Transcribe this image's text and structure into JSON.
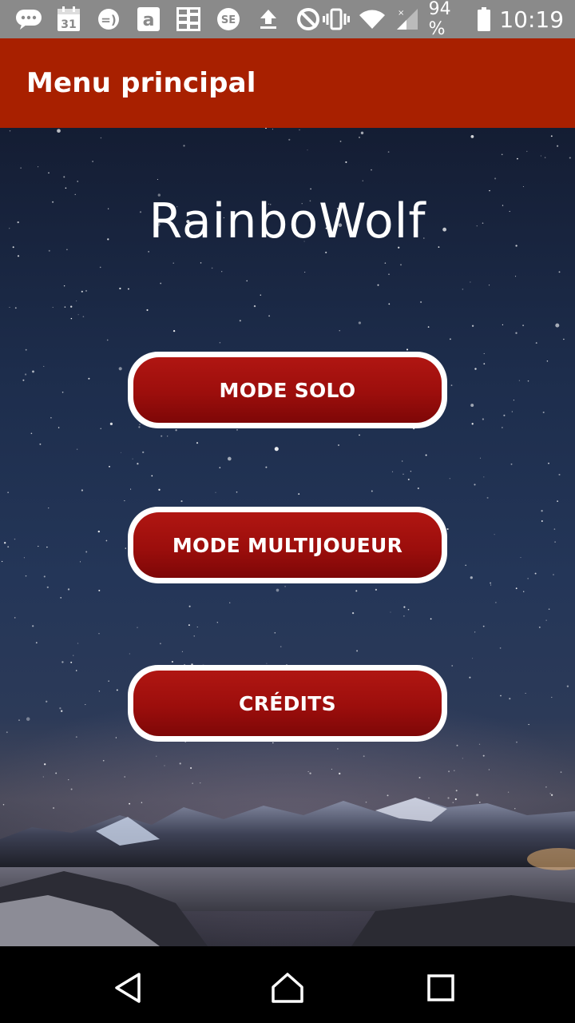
{
  "status_bar": {
    "battery_percent": "94 %",
    "time": "10:19",
    "icons": [
      "chat-bubble-icon",
      "calendar-icon",
      "message-icon",
      "amazon-icon",
      "app-grid-icon",
      "sf-icon",
      "upload-icon",
      "no-sync-icon",
      "vibrate-icon",
      "wifi-icon",
      "signal-icon",
      "battery-icon"
    ],
    "calendar_day": "31"
  },
  "app_bar": {
    "title": "Menu principal",
    "color": "#a82000"
  },
  "main": {
    "logo_text": "RainboWolf",
    "buttons": [
      {
        "label": "MODE SOLO"
      },
      {
        "label": "MODE MULTIJOUEUR"
      },
      {
        "label": "CRÉDITS"
      }
    ],
    "button_color": "#9c0e0c"
  },
  "nav_bar": {
    "icons": [
      "back-icon",
      "home-icon",
      "recents-icon"
    ]
  }
}
